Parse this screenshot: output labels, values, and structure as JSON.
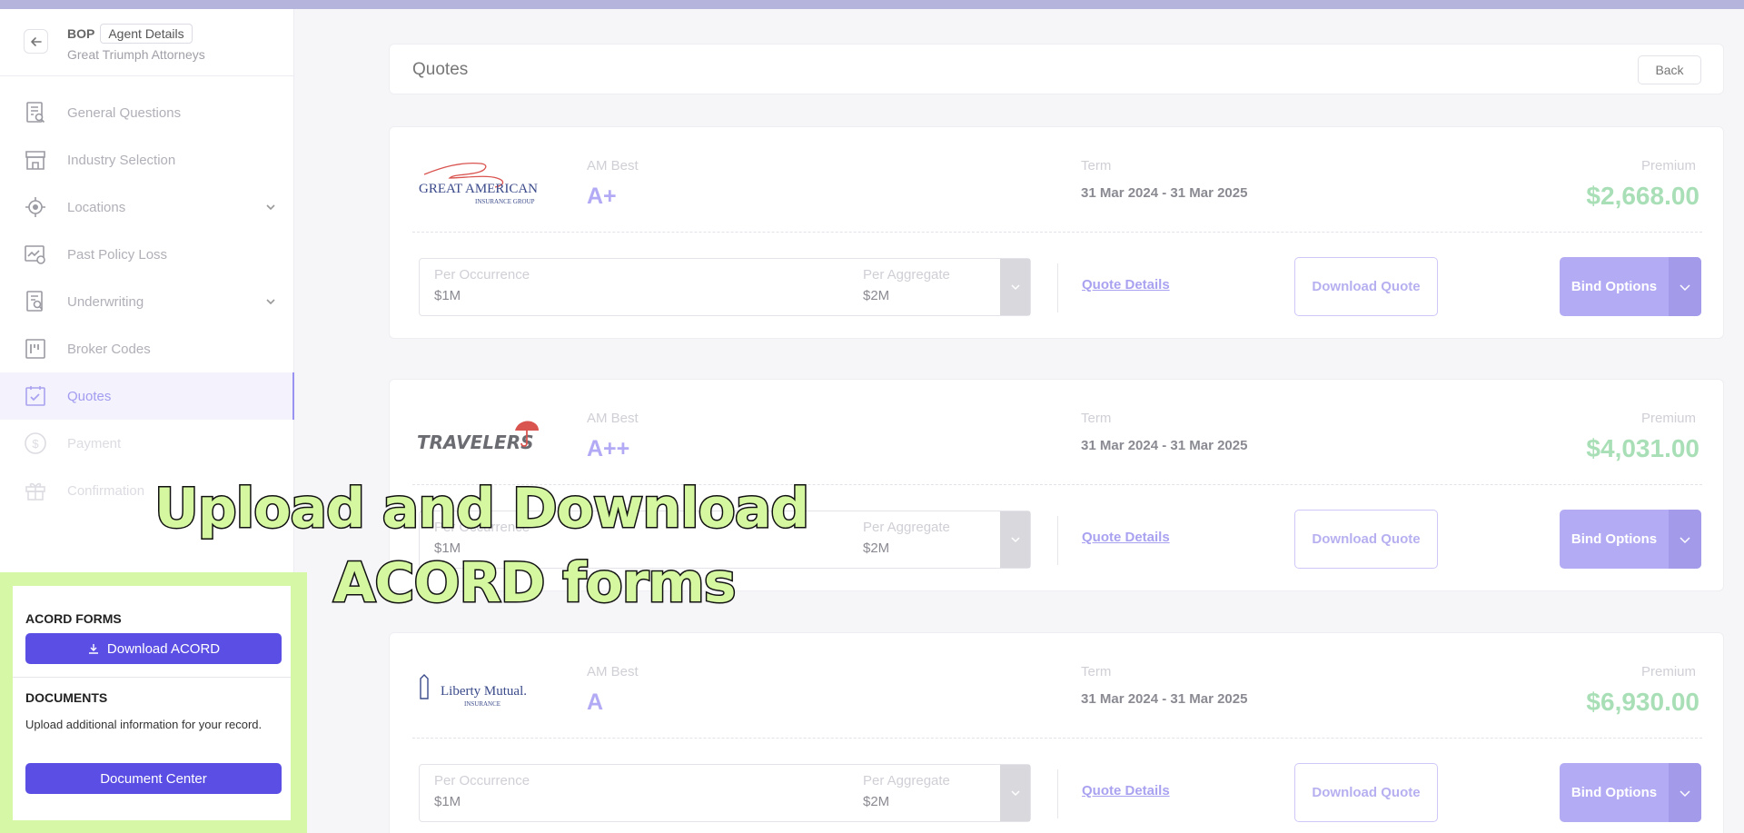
{
  "header": {
    "product": "BOP",
    "badge": "Agent Details",
    "company": "Great Triumph Attorneys"
  },
  "sidebar": {
    "items": [
      {
        "label": "General Questions",
        "icon": "document-search-icon"
      },
      {
        "label": "Industry Selection",
        "icon": "storefront-icon"
      },
      {
        "label": "Locations",
        "icon": "location-target-icon",
        "expandable": true
      },
      {
        "label": "Past Policy Loss",
        "icon": "chart-loss-icon"
      },
      {
        "label": "Underwriting",
        "icon": "document-search-icon",
        "expandable": true
      },
      {
        "label": "Broker Codes",
        "icon": "broker-code-icon"
      },
      {
        "label": "Quotes",
        "icon": "checklist-icon",
        "active": true
      },
      {
        "label": "Payment",
        "icon": "dollar-icon"
      },
      {
        "label": "Confirmation",
        "icon": "gift-icon"
      }
    ]
  },
  "acord": {
    "forms_title": "ACORD FORMS",
    "download_label": "Download ACORD",
    "documents_title": "DOCUMENTS",
    "documents_text": "Upload additional information for your record.",
    "document_center_label": "Document Center"
  },
  "main": {
    "title": "Quotes",
    "back_label": "Back"
  },
  "labels": {
    "am_best": "AM Best",
    "term": "Term",
    "premium": "Premium",
    "per_occurrence": "Per Occurrence",
    "per_aggregate": "Per Aggregate",
    "quote_details": "Quote Details",
    "download_quote": "Download Quote",
    "bind_options": "Bind Options"
  },
  "quotes": [
    {
      "carrier": "Great American Insurance Group",
      "logo_text": "GREAT AMERICAN",
      "logo_sub": "INSURANCE GROUP",
      "am_best": "A+",
      "term": "31 Mar 2024 - 31 Mar 2025",
      "premium": "$2,668.00",
      "per_occurrence": "$1M",
      "per_aggregate": "$2M"
    },
    {
      "carrier": "Travelers",
      "logo_text": "TRAVELERS",
      "am_best": "A++",
      "term": "31 Mar 2024 - 31 Mar 2025",
      "premium": "$4,031.00",
      "per_occurrence": "$1M",
      "per_aggregate": "$2M"
    },
    {
      "carrier": "Liberty Mutual Insurance",
      "logo_text": "Liberty Mutual.",
      "logo_sub": "INSURANCE",
      "am_best": "A",
      "term": "31 Mar 2024 - 31 Mar 2025",
      "premium": "$6,930.00",
      "per_occurrence": "$1M",
      "per_aggregate": "$2M"
    }
  ],
  "overlay": {
    "line1": "Upload and Download",
    "line2": "ACORD forms"
  },
  "colors": {
    "accent": "#5b4ee4",
    "highlight": "#d6f7a6",
    "premium": "#a9dfb6"
  }
}
